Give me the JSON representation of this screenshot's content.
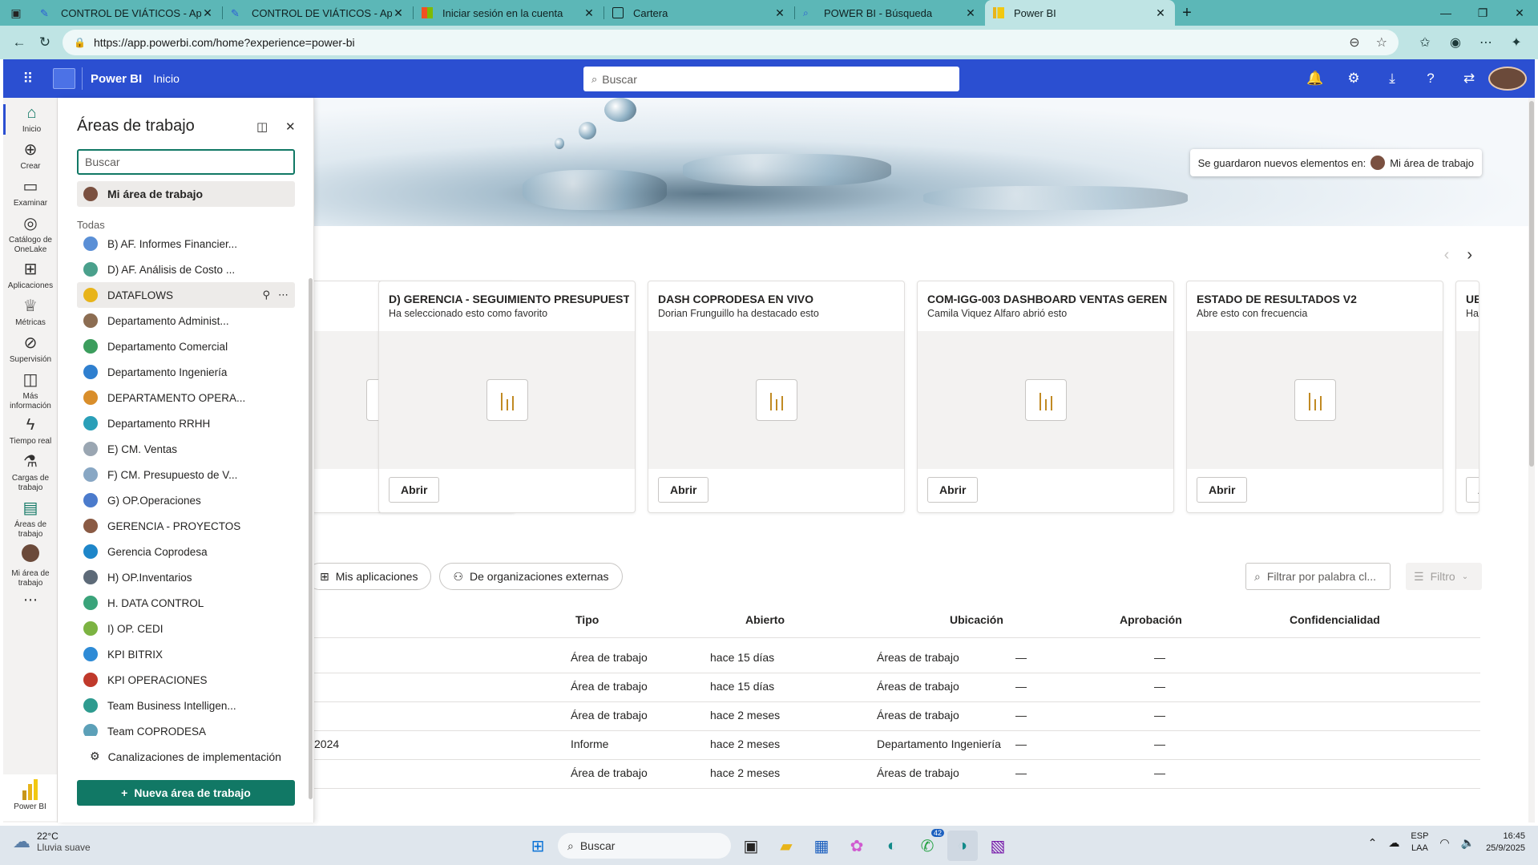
{
  "browser": {
    "tabs": [
      {
        "title": "CONTROL DE VIÁTICOS - AppShe",
        "active": false,
        "icon": "appsheet-icon"
      },
      {
        "title": "CONTROL DE VIÁTICOS - AppShe",
        "active": false,
        "icon": "appsheet-icon"
      },
      {
        "title": "Iniciar sesión en la cuenta",
        "active": false,
        "icon": "microsoft-icon"
      },
      {
        "title": "Cartera",
        "active": false,
        "icon": "wallet-icon"
      },
      {
        "title": "POWER BI - Búsqueda",
        "active": false,
        "icon": "search-icon"
      },
      {
        "title": "Power BI",
        "active": true,
        "icon": "powerbi-icon"
      }
    ],
    "url": "https://app.powerbi.com/home?experience=power-bi"
  },
  "header": {
    "brand": "Power BI",
    "section": "Inicio",
    "search_placeholder": "Buscar"
  },
  "leftnav": [
    {
      "label": "Inicio",
      "icon": "home-icon",
      "selected": true
    },
    {
      "label": "Crear",
      "icon": "plus-circle-icon"
    },
    {
      "label": "Examinar",
      "icon": "folder-icon"
    },
    {
      "label": "Catálogo de OneLake",
      "icon": "onelake-icon"
    },
    {
      "label": "Aplicaciones",
      "icon": "apps-icon"
    },
    {
      "label": "Métricas",
      "icon": "trophy-icon"
    },
    {
      "label": "Supervisión",
      "icon": "monitor-icon"
    },
    {
      "label": "Más información",
      "icon": "book-icon"
    },
    {
      "label": "Tiempo real",
      "icon": "lightning-icon"
    },
    {
      "label": "Cargas de trabajo",
      "icon": "workloads-icon"
    },
    {
      "label": "Áreas de trabajo",
      "icon": "workspaces-icon"
    },
    {
      "label": "Mi área de trabajo",
      "icon": "avatar"
    }
  ],
  "nav_bottom": "Power BI",
  "panel": {
    "title": "Áreas de trabajo",
    "search_placeholder": "Buscar",
    "my_workspace": "Mi área de trabajo",
    "section_label": "Todas",
    "workspaces": [
      "B) AF. Informes Financier...",
      "D) AF. Análisis de Costo ...",
      "DATAFLOWS",
      "Departamento Administ...",
      "Departamento Comercial",
      "Departamento Ingeniería",
      "DEPARTAMENTO OPERA...",
      "Departamento RRHH",
      "E) CM. Ventas",
      "F) CM. Presupuesto de V...",
      "G) OP.Operaciones",
      "GERENCIA - PROYECTOS",
      "Gerencia Coprodesa",
      "H) OP.Inventarios",
      "H. DATA CONTROL",
      "I) OP. CEDI",
      "KPI BITRIX",
      "KPI OPERACIONES",
      "Team Business Intelligen...",
      "Team COPRODESA"
    ],
    "pipelines": "Canalizaciones de implementación",
    "new_button": "Nueva área de trabajo"
  },
  "toast": {
    "text": "Se guardaron nuevos elementos en:",
    "workspace": "Mi área de trabajo"
  },
  "cards": [
    {
      "title": "D) GERENCIA - SEGUIMIENTO PRESUPUESTO",
      "subtitle": "Ha seleccionado esto como favorito",
      "button": "Abrir"
    },
    {
      "title": "DASH COPRODESA EN VIVO",
      "subtitle": "Dorian Frunguillo ha destacado esto",
      "button": "Abrir"
    },
    {
      "title": "COM-IGG-003 DASHBOARD VENTAS GEREN...",
      "subtitle": "Camila Viquez Alfaro abrió esto",
      "button": "Abrir"
    },
    {
      "title": "ESTADO DE RESULTADOS V2",
      "subtitle": "Abre esto con frecuencia",
      "button": "Abrir"
    },
    {
      "title": "UBI",
      "subtitle": "Ha s",
      "button": "Ab"
    }
  ],
  "filters": {
    "pill1": "Mis aplicaciones",
    "pill2": "De organizaciones externas",
    "filter_placeholder": "Filtrar por palabra cl...",
    "filter_button": "Filtro"
  },
  "table": {
    "headers": [
      "Tipo",
      "Abierto",
      "Ubicación",
      "Aprobación",
      "Confidencialidad"
    ],
    "rows": [
      {
        "name": "",
        "tipo": "Área de trabajo",
        "abierto": "hace 15 días",
        "ubicacion": "Áreas de trabajo",
        "aprobacion": "—",
        "conf": "—"
      },
      {
        "name": "",
        "tipo": "Área de trabajo",
        "abierto": "hace 15 días",
        "ubicacion": "Áreas de trabajo",
        "aprobacion": "—",
        "conf": "—"
      },
      {
        "name": "",
        "tipo": "Área de trabajo",
        "abierto": "hace 2 meses",
        "ubicacion": "Áreas de trabajo",
        "aprobacion": "—",
        "conf": "—"
      },
      {
        "name": "2024",
        "tipo": "Informe",
        "abierto": "hace 2 meses",
        "ubicacion": "Departamento Ingeniería",
        "aprobacion": "—",
        "conf": "—"
      },
      {
        "name": "",
        "tipo": "Área de trabajo",
        "abierto": "hace 2 meses",
        "ubicacion": "Áreas de trabajo",
        "aprobacion": "—",
        "conf": "—"
      }
    ]
  },
  "taskbar": {
    "temp": "22°C",
    "weather": "Lluvia suave",
    "search": "Buscar",
    "badge": "42",
    "lang1": "ESP",
    "lang2": "LAA",
    "time": "16:45",
    "date": "25/9/2025"
  }
}
